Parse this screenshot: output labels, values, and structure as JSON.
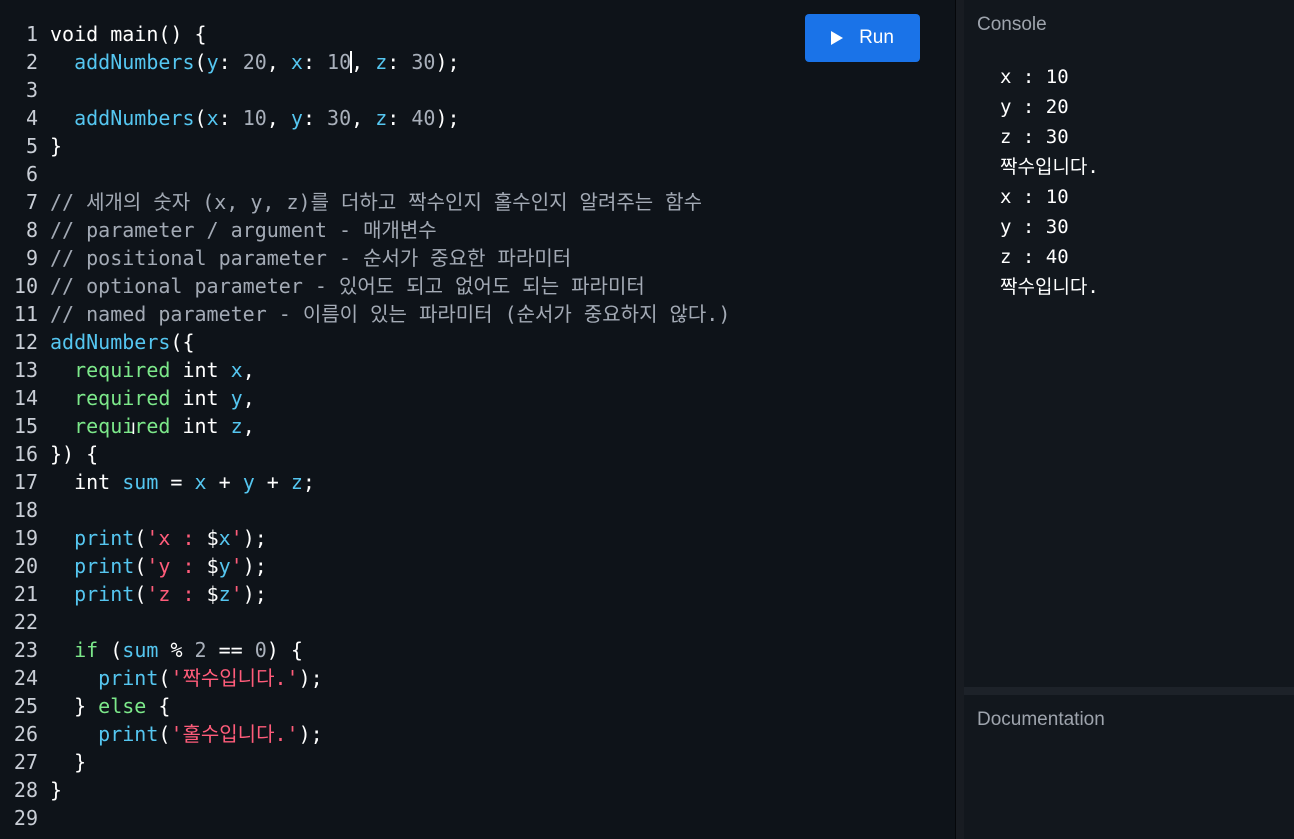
{
  "toolbar": {
    "run_label": "Run",
    "run_icon": "play-icon"
  },
  "console": {
    "title": "Console",
    "lines": [
      "x : 10",
      "y : 20",
      "z : 30",
      "짝수입니다.",
      "x : 10",
      "y : 30",
      "z : 40",
      "짝수입니다."
    ]
  },
  "documentation": {
    "title": "Documentation"
  },
  "editor": {
    "lines": [
      {
        "n": "1",
        "tokens": [
          [
            "kw",
            "void "
          ],
          [
            "p",
            "main() {"
          ]
        ]
      },
      {
        "n": "2",
        "tokens": [
          [
            "p",
            "  "
          ],
          [
            "fn",
            "addNumbers"
          ],
          [
            "p",
            "("
          ],
          [
            "id",
            "y"
          ],
          [
            "p",
            ": "
          ],
          [
            "num",
            "20"
          ],
          [
            "p",
            ", "
          ],
          [
            "id",
            "x"
          ],
          [
            "p",
            ": "
          ],
          [
            "num",
            "10"
          ],
          [
            "caret",
            ""
          ],
          [
            "p",
            ", "
          ],
          [
            "id",
            "z"
          ],
          [
            "p",
            ": "
          ],
          [
            "num",
            "30"
          ],
          [
            "p",
            ");"
          ]
        ]
      },
      {
        "n": "3",
        "tokens": []
      },
      {
        "n": "4",
        "tokens": [
          [
            "p",
            "  "
          ],
          [
            "fn",
            "addNumbers"
          ],
          [
            "p",
            "("
          ],
          [
            "id",
            "x"
          ],
          [
            "p",
            ": "
          ],
          [
            "num",
            "10"
          ],
          [
            "p",
            ", "
          ],
          [
            "id",
            "y"
          ],
          [
            "p",
            ": "
          ],
          [
            "num",
            "30"
          ],
          [
            "p",
            ", "
          ],
          [
            "id",
            "z"
          ],
          [
            "p",
            ": "
          ],
          [
            "num",
            "40"
          ],
          [
            "p",
            ");"
          ]
        ]
      },
      {
        "n": "5",
        "tokens": [
          [
            "p",
            "}"
          ]
        ]
      },
      {
        "n": "6",
        "tokens": []
      },
      {
        "n": "7",
        "tokens": [
          [
            "cm",
            "// 세개의 숫자 (x, y, z)를 더하고 짝수인지 홀수인지 알려주는 함수"
          ]
        ]
      },
      {
        "n": "8",
        "tokens": [
          [
            "cm",
            "// parameter / argument - 매개변수"
          ]
        ]
      },
      {
        "n": "9",
        "tokens": [
          [
            "cm",
            "// positional parameter - 순서가 중요한 파라미터"
          ]
        ]
      },
      {
        "n": "10",
        "tokens": [
          [
            "cm",
            "// optional parameter - 있어도 되고 없어도 되는 파라미터"
          ]
        ]
      },
      {
        "n": "11",
        "tokens": [
          [
            "cm",
            "// named parameter - 이름이 있는 파라미터 (순서가 중요하지 않다.)"
          ]
        ]
      },
      {
        "n": "12",
        "tokens": [
          [
            "fn",
            "addNumbers"
          ],
          [
            "p",
            "({"
          ]
        ]
      },
      {
        "n": "13",
        "tokens": [
          [
            "p",
            "  "
          ],
          [
            "req",
            "required"
          ],
          [
            "p",
            " "
          ],
          [
            "ty",
            "int"
          ],
          [
            "p",
            " "
          ],
          [
            "id",
            "x"
          ],
          [
            "p",
            ","
          ]
        ]
      },
      {
        "n": "14",
        "tokens": [
          [
            "p",
            "  "
          ],
          [
            "req",
            "required"
          ],
          [
            "p",
            " "
          ],
          [
            "ty",
            "int"
          ],
          [
            "p",
            " "
          ],
          [
            "id",
            "y"
          ],
          [
            "p",
            ","
          ]
        ]
      },
      {
        "n": "15",
        "tokens": [
          [
            "p",
            "  "
          ],
          [
            "req",
            "required"
          ],
          [
            "p",
            " "
          ],
          [
            "ty",
            "int"
          ],
          [
            "p",
            " "
          ],
          [
            "id",
            "z"
          ],
          [
            "p",
            ","
          ]
        ]
      },
      {
        "n": "16",
        "tokens": [
          [
            "p",
            "}) {"
          ]
        ]
      },
      {
        "n": "17",
        "tokens": [
          [
            "p",
            "  "
          ],
          [
            "ty",
            "int"
          ],
          [
            "p",
            " "
          ],
          [
            "id",
            "sum"
          ],
          [
            "p",
            " = "
          ],
          [
            "id",
            "x"
          ],
          [
            "p",
            " + "
          ],
          [
            "id",
            "y"
          ],
          [
            "p",
            " + "
          ],
          [
            "id",
            "z"
          ],
          [
            "p",
            ";"
          ]
        ]
      },
      {
        "n": "18",
        "tokens": []
      },
      {
        "n": "19",
        "tokens": [
          [
            "p",
            "  "
          ],
          [
            "fn",
            "print"
          ],
          [
            "p",
            "("
          ],
          [
            "str",
            "'x : "
          ],
          [
            "p",
            "$"
          ],
          [
            "id",
            "x"
          ],
          [
            "str",
            "'"
          ],
          [
            "p",
            ");"
          ]
        ]
      },
      {
        "n": "20",
        "tokens": [
          [
            "p",
            "  "
          ],
          [
            "fn",
            "print"
          ],
          [
            "p",
            "("
          ],
          [
            "str",
            "'y : "
          ],
          [
            "p",
            "$"
          ],
          [
            "id",
            "y"
          ],
          [
            "str",
            "'"
          ],
          [
            "p",
            ");"
          ]
        ]
      },
      {
        "n": "21",
        "tokens": [
          [
            "p",
            "  "
          ],
          [
            "fn",
            "print"
          ],
          [
            "p",
            "("
          ],
          [
            "str",
            "'z : "
          ],
          [
            "p",
            "$"
          ],
          [
            "id",
            "z"
          ],
          [
            "str",
            "'"
          ],
          [
            "p",
            ");"
          ]
        ]
      },
      {
        "n": "22",
        "tokens": []
      },
      {
        "n": "23",
        "tokens": [
          [
            "p",
            "  "
          ],
          [
            "req",
            "if"
          ],
          [
            "p",
            " ("
          ],
          [
            "id",
            "sum"
          ],
          [
            "p",
            " % "
          ],
          [
            "num",
            "2"
          ],
          [
            "p",
            " == "
          ],
          [
            "num",
            "0"
          ],
          [
            "p",
            ") {"
          ]
        ]
      },
      {
        "n": "24",
        "tokens": [
          [
            "p",
            "    "
          ],
          [
            "fn",
            "print"
          ],
          [
            "p",
            "("
          ],
          [
            "str",
            "'짝수입니다.'"
          ],
          [
            "p",
            ");"
          ]
        ]
      },
      {
        "n": "25",
        "tokens": [
          [
            "p",
            "  } "
          ],
          [
            "req",
            "else"
          ],
          [
            "p",
            " {"
          ]
        ]
      },
      {
        "n": "26",
        "tokens": [
          [
            "p",
            "    "
          ],
          [
            "fn",
            "print"
          ],
          [
            "p",
            "("
          ],
          [
            "str",
            "'홀수입니다.'"
          ],
          [
            "p",
            ");"
          ]
        ]
      },
      {
        "n": "27",
        "tokens": [
          [
            "p",
            "  }"
          ]
        ]
      },
      {
        "n": "28",
        "tokens": [
          [
            "p",
            "}"
          ]
        ]
      },
      {
        "n": "29",
        "tokens": []
      }
    ]
  },
  "colors": {
    "accent": "#1a73e8",
    "identifier": "#55c6f0",
    "keyword_green": "#7ce88a",
    "string": "#ff5c7a",
    "comment": "#a3aab5"
  }
}
